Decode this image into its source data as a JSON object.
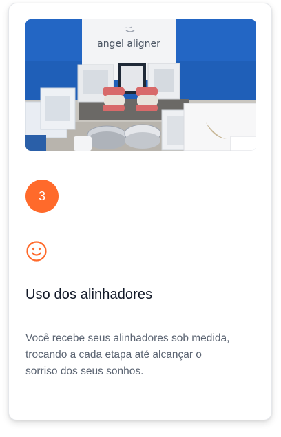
{
  "card": {
    "image": {
      "alt": "Kit de alinhadores angel aligner",
      "brand_text": "angel aligner"
    },
    "step_number": "3",
    "icon": "smile-icon",
    "title": "Uso dos alinhadores",
    "description": "Você recebe seus alinhadores sob medida, trocando a cada etapa até alcançar o sorriso dos seus sonhos."
  },
  "colors": {
    "accent": "#ff6a2b",
    "title": "#111827",
    "body_text": "#5b6472",
    "photo_background": "#1f5fb8"
  }
}
